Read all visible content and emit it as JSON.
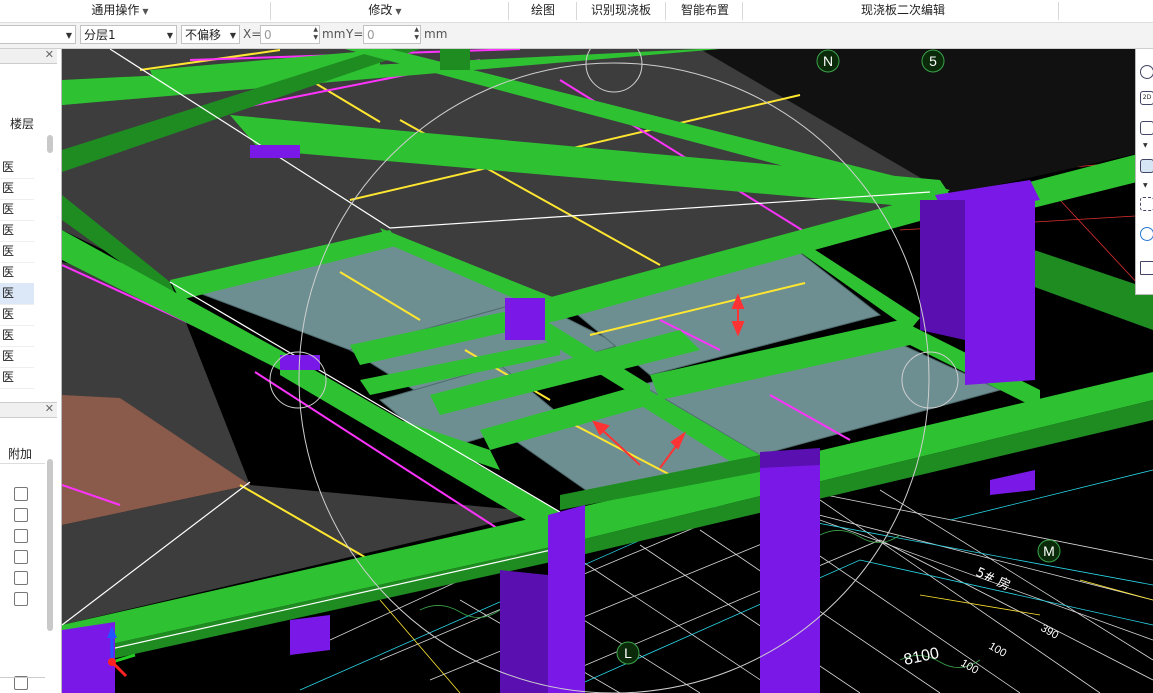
{
  "ribbon": {
    "general_ops": "通用操作",
    "modify": "修改",
    "draw": "绘图",
    "identify_slab": "识别现浇板",
    "smart_layout": "智能布置",
    "slab_edit": "现浇板二次编辑"
  },
  "options": {
    "layer": "分层1",
    "offset": "不偏移",
    "x_label": "X=",
    "x_value": "0",
    "mm1": "mm",
    "y_label": "Y=",
    "y_value": "0",
    "mm2": "mm"
  },
  "left_panel": {
    "floor_header": "楼层",
    "floor_items": [
      "医",
      "医",
      "医",
      "医",
      "医",
      "医",
      "医",
      "医",
      "医",
      "医",
      "医"
    ],
    "selected_index": 6,
    "prop_header": "附加",
    "checkbox_count": 6
  },
  "viewport": {
    "axis_labels": [
      "N",
      "5",
      "M",
      "L"
    ],
    "dimension_text": "8100",
    "dim_small": [
      "100",
      "100",
      "390"
    ],
    "cad_note_text": "5# 房"
  },
  "colors": {
    "beam": "#2ec232",
    "beam_dark": "#1f8c22",
    "column": "#7a18e8",
    "column_dark": "#5a0fb0",
    "slab_dark": "#3a3a3a",
    "slab_light": "#6a8f90",
    "rebar_yellow": "#ffe631",
    "rebar_magenta": "#ff33ff",
    "background": "#000000"
  },
  "right_toolbar": {
    "icons": [
      "orbit-icon",
      "2d-icon",
      "box-icon",
      "box-icon",
      "select-icon",
      "rotate-icon",
      "list-icon"
    ],
    "label_2d": "2D"
  }
}
